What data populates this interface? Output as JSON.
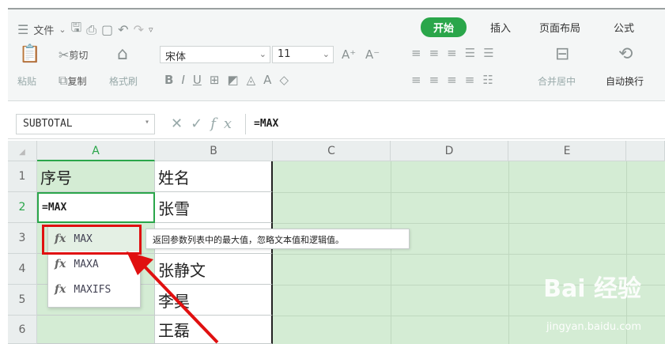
{
  "quick_access": {
    "menu_label": "文件",
    "menu_icon": "hamburger-icon"
  },
  "tabs": [
    {
      "label": "开始",
      "active": true
    },
    {
      "label": "插入",
      "active": false
    },
    {
      "label": "页面布局",
      "active": false
    },
    {
      "label": "公式",
      "active": false
    }
  ],
  "clipboard": {
    "cut": "剪切",
    "copy": "复制",
    "paste": "粘贴",
    "format_painter": "格式刷"
  },
  "font": {
    "name": "宋体",
    "size": "11"
  },
  "alignment": {
    "merge_center": "合并居中",
    "wrap_text": "自动换行"
  },
  "formula_bar": {
    "name_box": "SUBTOTAL",
    "formula": "=MAX",
    "fx_label": "fx"
  },
  "columns": [
    "A",
    "B",
    "C",
    "D",
    "E"
  ],
  "rows": [
    {
      "num": "1",
      "a": "序号",
      "b": "姓名"
    },
    {
      "num": "2",
      "a": "=MAX",
      "b": "张雪"
    },
    {
      "num": "3",
      "a": "",
      "b": ""
    },
    {
      "num": "4",
      "a": "",
      "b": "张静文"
    },
    {
      "num": "5",
      "a": "",
      "b": "李昊"
    },
    {
      "num": "6",
      "a": "",
      "b": "王磊"
    }
  ],
  "autocomplete": {
    "items": [
      {
        "fx": "fx",
        "name": "MAX"
      },
      {
        "fx": "fx",
        "name": "MAXA"
      },
      {
        "fx": "fx",
        "name": "MAXIFS"
      }
    ],
    "tooltip": "返回参数列表中的最大值，忽略文本值和逻辑值。"
  },
  "watermark": {
    "brand": "Bai 经验",
    "url": "jingyan.baidu.com"
  },
  "colors": {
    "accent": "#2aa64a",
    "grid_bg": "#d4ecd4",
    "highlight": "#e01010"
  }
}
